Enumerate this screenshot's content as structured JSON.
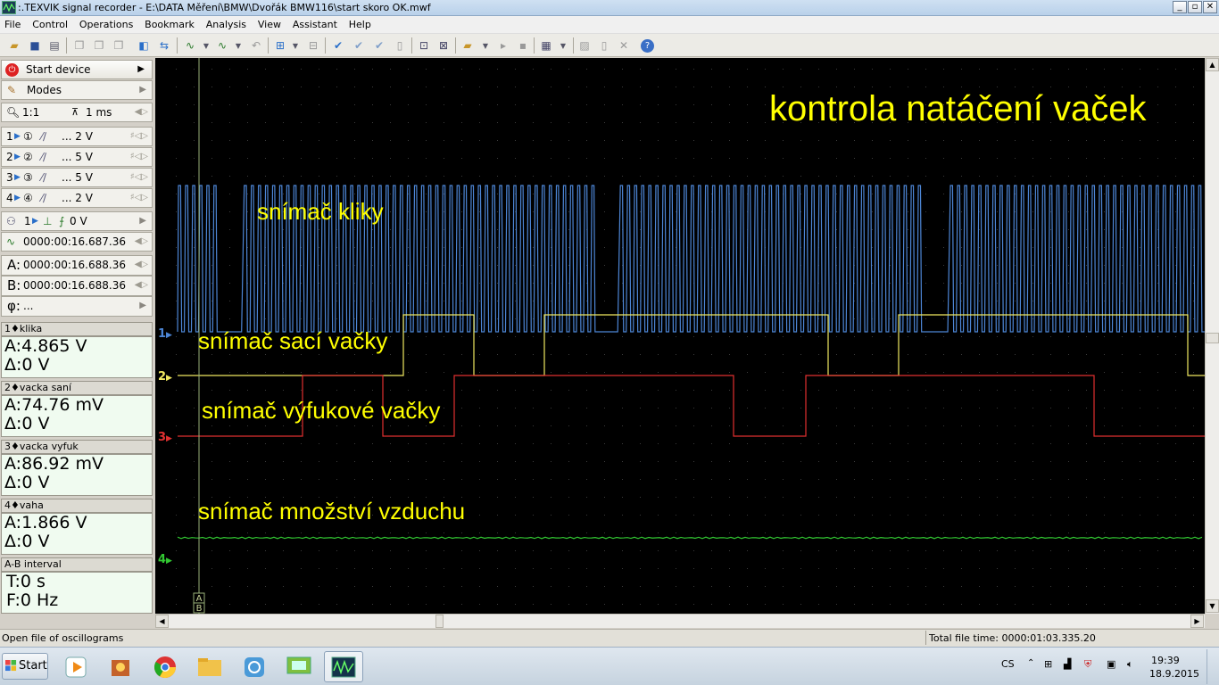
{
  "window": {
    "title": ":.TEXVIK  signal recorder - E:\\DATA Měření\\BMW\\Dvořák BMW116\\start skoro OK.mwf",
    "min": "_",
    "restore": "▫",
    "close": "✕"
  },
  "menu": [
    "File",
    "Control",
    "Operations",
    "Bookmark",
    "Analysis",
    "View",
    "Assistant",
    "Help"
  ],
  "sidebar": {
    "start_device": "Start device",
    "modes": "Modes",
    "zoom": "1:1",
    "timebase": "1 ms",
    "channels": [
      {
        "num": "1",
        "circle": "①",
        "range": "... 2 V"
      },
      {
        "num": "2",
        "circle": "②",
        "range": "... 5 V"
      },
      {
        "num": "3",
        "circle": "③",
        "range": "... 5 V"
      },
      {
        "num": "4",
        "circle": "④",
        "range": "... 2 V"
      }
    ],
    "trigger": {
      "channel": "1",
      "level": "0 V"
    },
    "trigger_time": "0000:00:16.687.36",
    "cursor_a": "0000:00:16.688.36",
    "cursor_b": "0000:00:16.688.36",
    "phi": "...",
    "label_a": "A:",
    "label_b": "B:",
    "label_phi": "φ:"
  },
  "measurements": [
    {
      "title": "1♦klika",
      "a": "A:4.865 V",
      "d": "Δ:0 V"
    },
    {
      "title": "2♦vacka saní",
      "a": "A:74.76 mV",
      "d": "Δ:0 V"
    },
    {
      "title": "3♦vacka vyfuk",
      "a": "A:86.92 mV",
      "d": "Δ:0 V"
    },
    {
      "title": "4♦vaha",
      "a": "A:1.866 V",
      "d": "Δ:0 V"
    }
  ],
  "ab_interval": {
    "title": "A-B interval",
    "t": "T:0 s",
    "f": "F:0 Hz"
  },
  "scope": {
    "heading": "kontrola natáčení vaček",
    "labels": {
      "crank": "snímač kliky",
      "intake": "snímač sací vačky",
      "exhaust": "snímač výfukové vačky",
      "air": "snímač množství vzduchu"
    },
    "channel_markers": [
      "1",
      "2",
      "3",
      "4"
    ],
    "cursor_tag": [
      "A",
      "B"
    ],
    "colors": {
      "ch1": "#4d86d6",
      "ch2": "#f0e860",
      "ch3": "#e03030",
      "ch4": "#32c832",
      "grid": "#3c3c3c",
      "label": "#ffff00"
    }
  },
  "status": {
    "left": "Open file of oscillograms",
    "right": "Total file time: 0000:01:03.335.20"
  },
  "taskbar": {
    "start": "Start",
    "lang": "CS",
    "time": "19:39",
    "date": "18.9.2015"
  }
}
